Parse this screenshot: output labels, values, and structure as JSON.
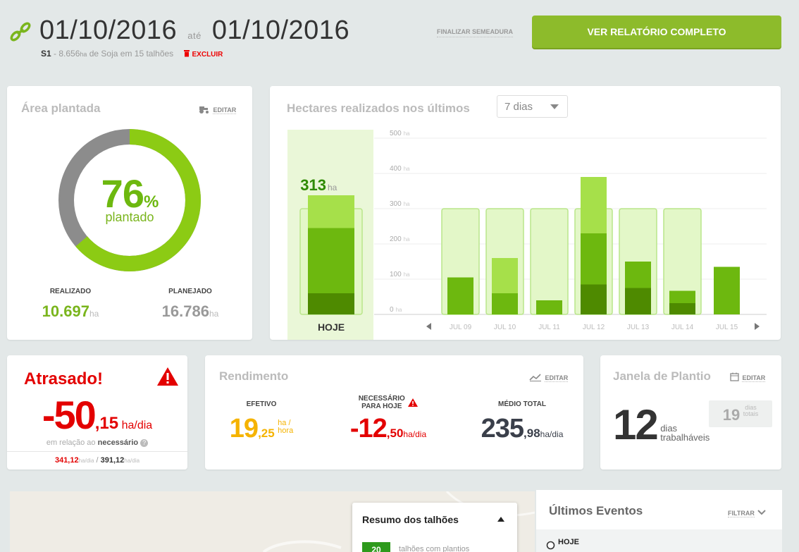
{
  "header": {
    "date_start": "01/10/2016",
    "ate": "até",
    "date_end": "01/10/2016",
    "season": "S1",
    "summary": "- 8.656",
    "summary_unit": "ha",
    "summary_rest": "de Soja em 15 talhões",
    "delete_label": "EXCLUIR",
    "finalize_label": "FINALIZAR SEMEADURA",
    "report_label": "VER RELATÓRIO COMPLETO"
  },
  "area": {
    "title": "Área plantada",
    "edit_label": "EDITAR",
    "percent": "76",
    "percent_sign": "%",
    "percent_label": "plantado",
    "realizado_label": "REALIZADO",
    "realizado_value": "10.697",
    "planejado_label": "PLANEJADO",
    "planejado_value": "16.786",
    "unit": "ha"
  },
  "chart_header": {
    "title": "Hectares realizados nos últimos",
    "period": "7 dias",
    "today_value": "313",
    "today_unit": "ha",
    "today_label": "HOJE"
  },
  "chart_data": {
    "type": "bar",
    "unit": "ha",
    "ylim": [
      0,
      500
    ],
    "yticks": [
      500,
      400,
      300,
      200,
      100,
      0
    ],
    "categories": [
      "HOJE",
      "JUL 09",
      "JUL 10",
      "JUL 11",
      "JUL 12",
      "JUL 13",
      "JUL 14",
      "JUL 15"
    ],
    "planned": [
      300,
      300,
      300,
      300,
      300,
      300,
      300,
      0
    ],
    "series": [
      {
        "values": [
          60,
          0,
          0,
          0,
          85,
          75,
          32,
          0
        ],
        "color": "#4e8a00"
      },
      {
        "values": [
          185,
          105,
          60,
          40,
          145,
          75,
          35,
          135
        ],
        "color": "#6db80f"
      },
      {
        "values": [
          93,
          0,
          100,
          0,
          160,
          0,
          0,
          0
        ],
        "color": "#a6e04a"
      }
    ],
    "grid": true
  },
  "atrasado": {
    "title": "Atrasado!",
    "value_int": "-50",
    "value_dec": ",15",
    "unit": "ha/dia",
    "relation": "em relação ao",
    "relation_bold": "necessário",
    "current": "341,12",
    "current_unit": "ha/dia",
    "sep": "/",
    "needed": "391,12",
    "needed_unit": "ha/dia",
    "color": "#e30000"
  },
  "rendimento": {
    "title": "Rendimento",
    "edit_label": "EDITAR",
    "efetivo_label": "EFETIVO",
    "efetivo_int": "19",
    "efetivo_dec": ",25",
    "efetivo_unit1": "ha /",
    "efetivo_unit2": "hora",
    "necessario_label1": "NECESSÁRIO",
    "necessario_label2": "PARA HOJE",
    "necessario_int": "-12",
    "necessario_dec": ",50",
    "necessario_unit": "ha/dia",
    "medio_label": "MÉDIO TOTAL",
    "medio_int": "235",
    "medio_dec": ",98",
    "medio_unit": "ha/dia"
  },
  "janela": {
    "title": "Janela de Plantio",
    "edit_label": "EDITAR",
    "dias": "12",
    "dias_label1": "dias",
    "dias_label2": "trabalháveis",
    "totais": "19",
    "totais_label1": "dias",
    "totais_label2": "totais"
  },
  "map": {
    "summary_title": "Resumo dos talhões",
    "summary_count": "20",
    "summary_text": "talhões com plantios"
  },
  "events": {
    "title": "Últimos Eventos",
    "filter_label": "FILTRAR",
    "first_group": "HOJE"
  }
}
